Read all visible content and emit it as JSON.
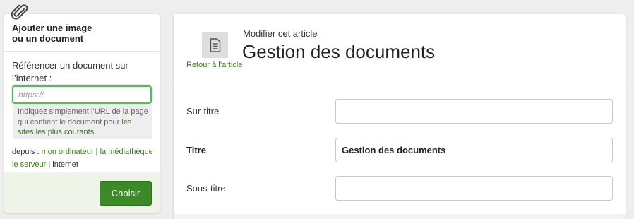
{
  "upload_panel": {
    "title_line1": "Ajouter une image",
    "title_line2": "ou un document",
    "ref_label": "Référencer un document sur l’internet :",
    "url_placeholder": "https://",
    "url_value": "",
    "help_text": "Indiquez simplement l’URL de la page qui contient le document pour ",
    "help_link": "les sites les plus courants",
    "help_end": ".",
    "from_prefix": "depuis : ",
    "from_links": [
      "mon ordinateur",
      "la médiathèque",
      "le serveur"
    ],
    "from_current": "internet",
    "sep": " | ",
    "choose_button": "Choisir"
  },
  "article": {
    "back_link": "Retour à l’article",
    "kicker": "Modifier cet article",
    "title": "Gestion des documents",
    "fields": [
      {
        "label": "Sur-titre",
        "value": "",
        "bold": false
      },
      {
        "label": "Titre",
        "value": "Gestion des documents",
        "bold": true
      },
      {
        "label": "Sous-titre",
        "value": "",
        "bold": false
      }
    ]
  },
  "colors": {
    "accent_green": "#3c8a26",
    "link_green": "#3a7d1c",
    "focus_green": "#5cb85c"
  },
  "icons": [
    "paperclip-icon",
    "document-icon"
  ]
}
